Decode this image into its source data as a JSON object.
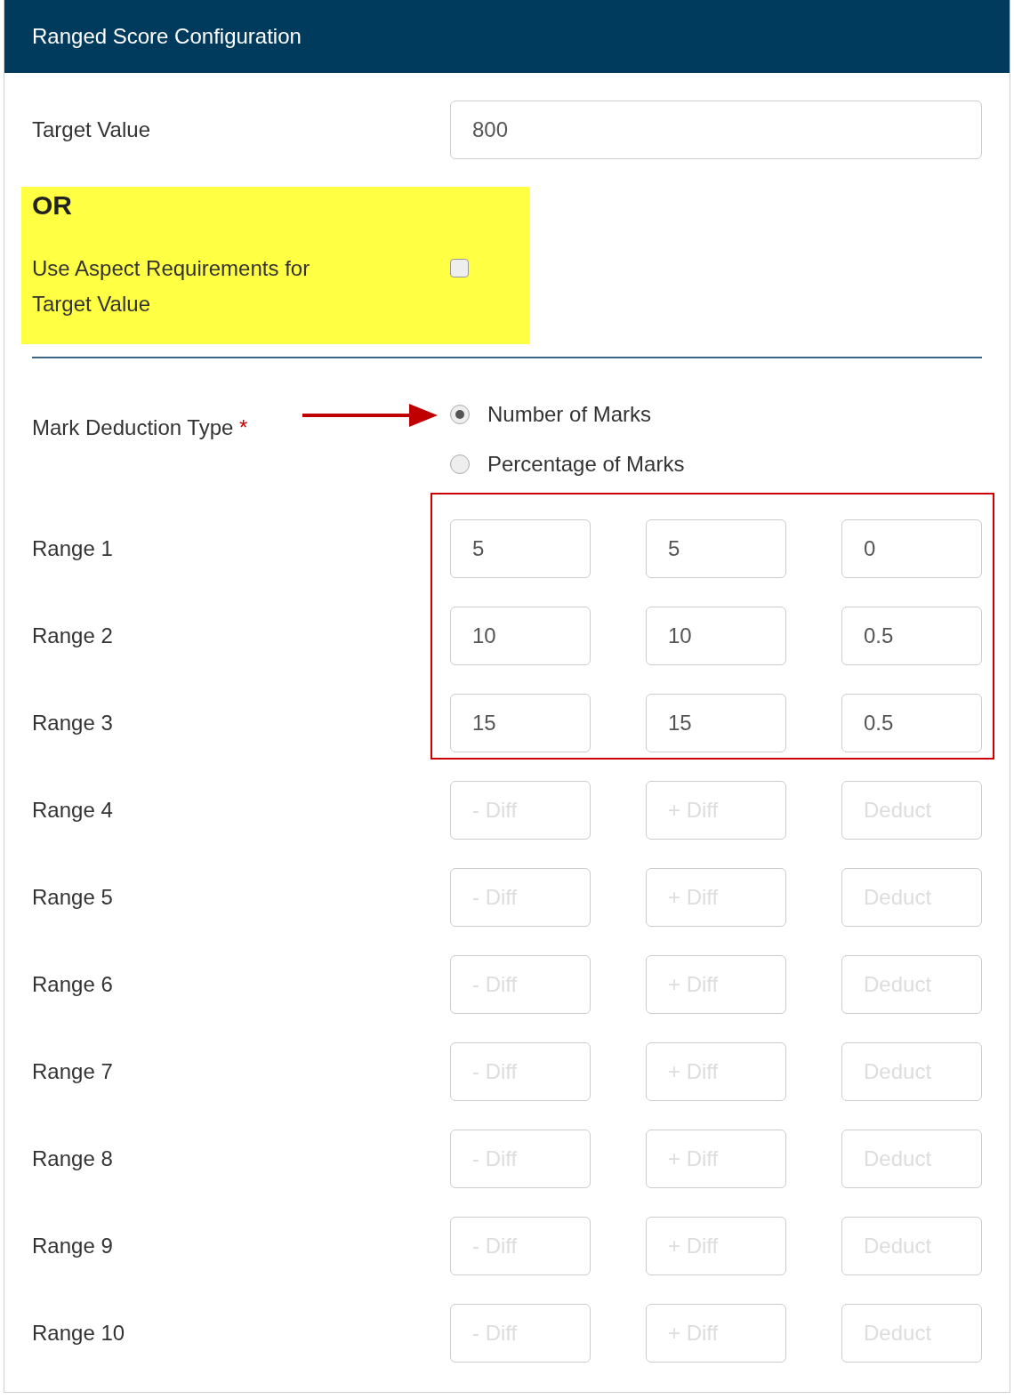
{
  "panel": {
    "title": "Ranged Score Configuration"
  },
  "target_value": {
    "label": "Target Value",
    "value": "800"
  },
  "or_block": {
    "heading": "OR",
    "label": "Use Aspect Requirements for Target Value",
    "checked": false
  },
  "mark_deduction": {
    "label": "Mark Deduction Type",
    "required_mark": "*",
    "options": [
      {
        "label": "Number of Marks",
        "selected": true
      },
      {
        "label": "Percentage of Marks",
        "selected": false
      }
    ]
  },
  "ranges": [
    {
      "label": "Range 1",
      "highlighted": true,
      "fields": [
        {
          "value": "5"
        },
        {
          "value": "5"
        },
        {
          "value": "0"
        }
      ]
    },
    {
      "label": "Range 2",
      "highlighted": true,
      "fields": [
        {
          "value": "10"
        },
        {
          "value": "10"
        },
        {
          "value": "0.5"
        }
      ]
    },
    {
      "label": "Range 3",
      "highlighted": true,
      "fields": [
        {
          "value": "15"
        },
        {
          "value": "15"
        },
        {
          "value": "0.5"
        }
      ]
    },
    {
      "label": "Range 4",
      "highlighted": false,
      "fields": [
        {
          "placeholder": "- Diff"
        },
        {
          "placeholder": "+ Diff"
        },
        {
          "placeholder": "Deduct"
        }
      ]
    },
    {
      "label": "Range 5",
      "highlighted": false,
      "fields": [
        {
          "placeholder": "- Diff"
        },
        {
          "placeholder": "+ Diff"
        },
        {
          "placeholder": "Deduct"
        }
      ]
    },
    {
      "label": "Range 6",
      "highlighted": false,
      "fields": [
        {
          "placeholder": "- Diff"
        },
        {
          "placeholder": "+ Diff"
        },
        {
          "placeholder": "Deduct"
        }
      ]
    },
    {
      "label": "Range 7",
      "highlighted": false,
      "fields": [
        {
          "placeholder": "- Diff"
        },
        {
          "placeholder": "+ Diff"
        },
        {
          "placeholder": "Deduct"
        }
      ]
    },
    {
      "label": "Range 8",
      "highlighted": false,
      "fields": [
        {
          "placeholder": "- Diff"
        },
        {
          "placeholder": "+ Diff"
        },
        {
          "placeholder": "Deduct"
        }
      ]
    },
    {
      "label": "Range 9",
      "highlighted": false,
      "fields": [
        {
          "placeholder": "- Diff"
        },
        {
          "placeholder": "+ Diff"
        },
        {
          "placeholder": "Deduct"
        }
      ]
    },
    {
      "label": "Range 10",
      "highlighted": false,
      "fields": [
        {
          "placeholder": "- Diff"
        },
        {
          "placeholder": "+ Diff"
        },
        {
          "placeholder": "Deduct"
        }
      ]
    }
  ]
}
